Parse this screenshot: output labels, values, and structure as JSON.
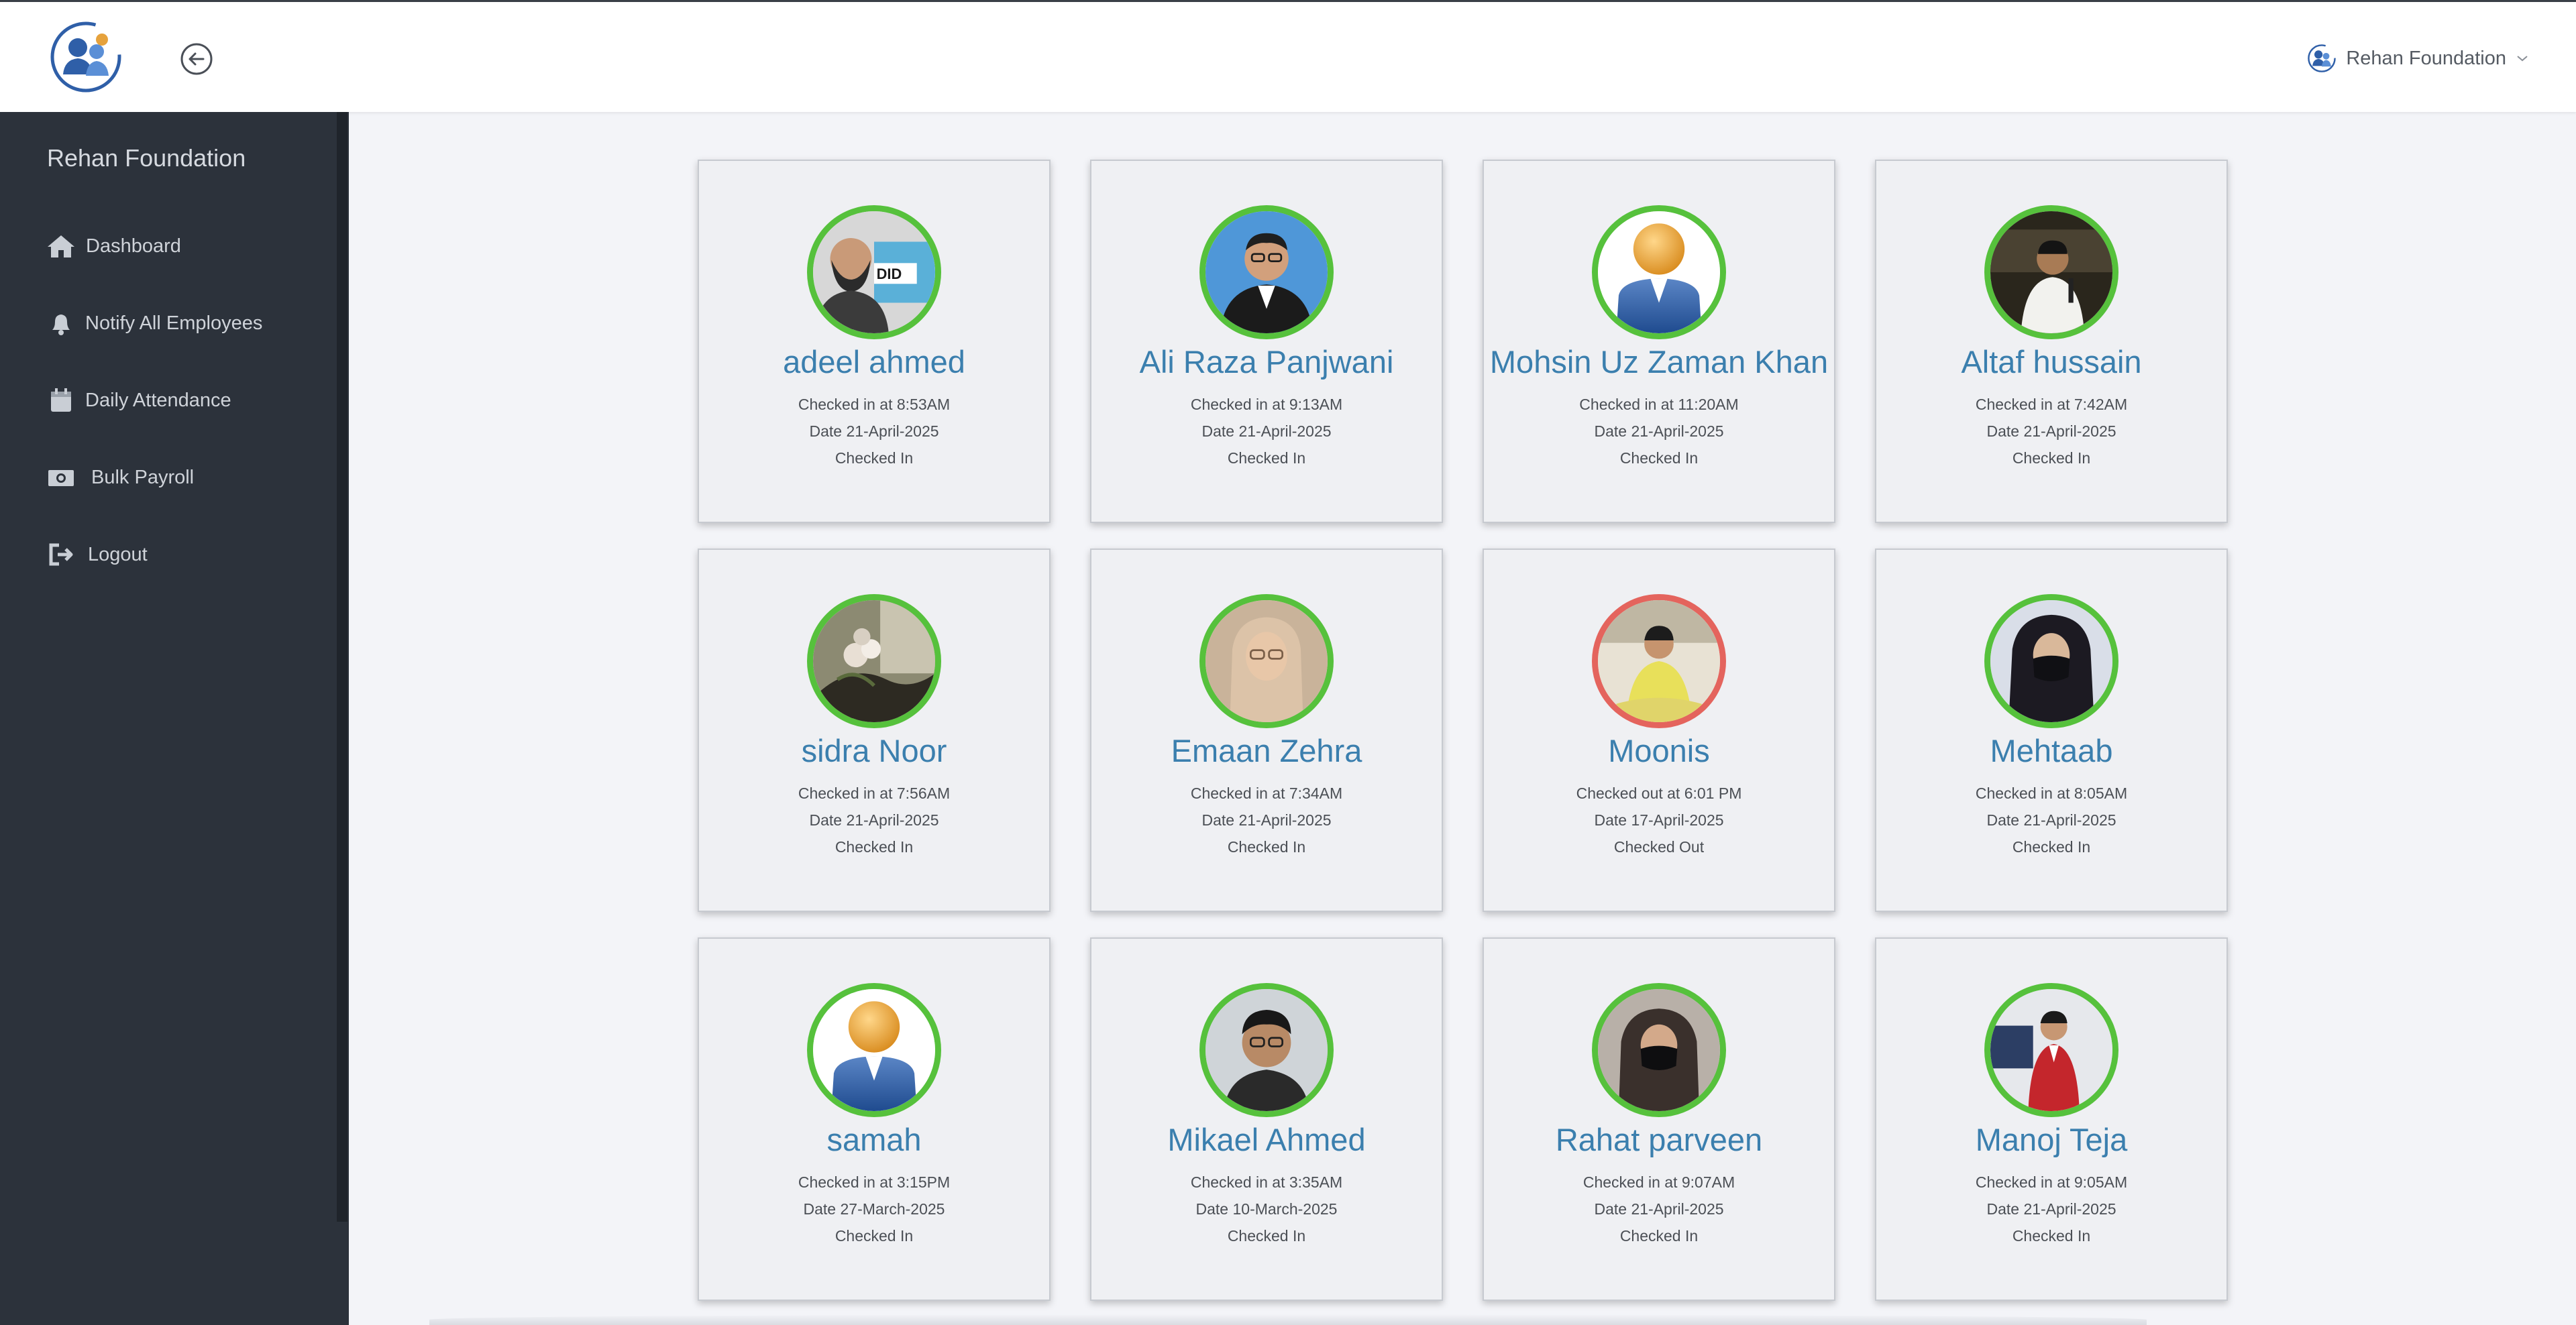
{
  "header": {
    "org_name": "Rehan Foundation",
    "logo_icon": "team-people-icon",
    "back_icon": "arrow-left-circle-icon"
  },
  "sidebar": {
    "title": "Rehan Foundation",
    "items": [
      {
        "label": "Dashboard",
        "icon": "home-icon"
      },
      {
        "label": "Notify All Employees",
        "icon": "bell-icon"
      },
      {
        "label": "Daily Attendance",
        "icon": "calendar-icon"
      },
      {
        "label": "Bulk Payroll",
        "icon": "money-icon"
      },
      {
        "label": "Logout",
        "icon": "logout-icon"
      }
    ]
  },
  "colors": {
    "checked_in_ring": "#56c13c",
    "checked_out_ring": "#e4645d",
    "name_text": "#3b7fae",
    "sidebar_bg": "#2c323b"
  },
  "employees": [
    {
      "name": "adeel ahmed",
      "time": "Checked in at 8:53AM",
      "date": "Date 21-April-2025",
      "status": "Checked In",
      "photo": "photo-man-beard"
    },
    {
      "name": "Ali Raza Panjwani",
      "time": "Checked in at 9:13AM",
      "date": "Date 21-April-2025",
      "status": "Checked In",
      "photo": "photo-man-glasses"
    },
    {
      "name": "Mohsin Uz Zaman Khan",
      "time": "Checked in at 11:20AM",
      "date": "Date 21-April-2025",
      "status": "Checked In",
      "photo": "default-avatar-icon"
    },
    {
      "name": "Altaf hussain",
      "time": "Checked in at 7:42AM",
      "date": "Date 21-April-2025",
      "status": "Checked In",
      "photo": "photo-man-speaking"
    },
    {
      "name": "sidra Noor",
      "time": "Checked in at 7:56AM",
      "date": "Date 21-April-2025",
      "status": "Checked In",
      "photo": "photo-flowers"
    },
    {
      "name": "Emaan Zehra",
      "time": "Checked in at 7:34AM",
      "date": "Date 21-April-2025",
      "status": "Checked In",
      "photo": "photo-woman-scarf"
    },
    {
      "name": "Moonis",
      "time": "Checked out at 6:01 PM",
      "date": "Date 17-April-2025",
      "status": "Checked Out",
      "photo": "photo-woman-yellow"
    },
    {
      "name": "Mehtaab",
      "time": "Checked in at 8:05AM",
      "date": "Date 21-April-2025",
      "status": "Checked In",
      "photo": "photo-woman-mask"
    },
    {
      "name": "samah",
      "time": "Checked in at 3:15PM",
      "date": "Date 27-March-2025",
      "status": "Checked In",
      "photo": "default-avatar-icon"
    },
    {
      "name": "Mikael Ahmed",
      "time": "Checked in at 3:35AM",
      "date": "Date 10-March-2025",
      "status": "Checked In",
      "photo": "photo-man-young"
    },
    {
      "name": "Rahat parveen",
      "time": "Checked in at 9:07AM",
      "date": "Date 21-April-2025",
      "status": "Checked In",
      "photo": "photo-woman-mask"
    },
    {
      "name": "Manoj Teja",
      "time": "Checked in at 9:05AM",
      "date": "Date 21-April-2025",
      "status": "Checked In",
      "photo": "photo-man-red-jacket"
    }
  ]
}
